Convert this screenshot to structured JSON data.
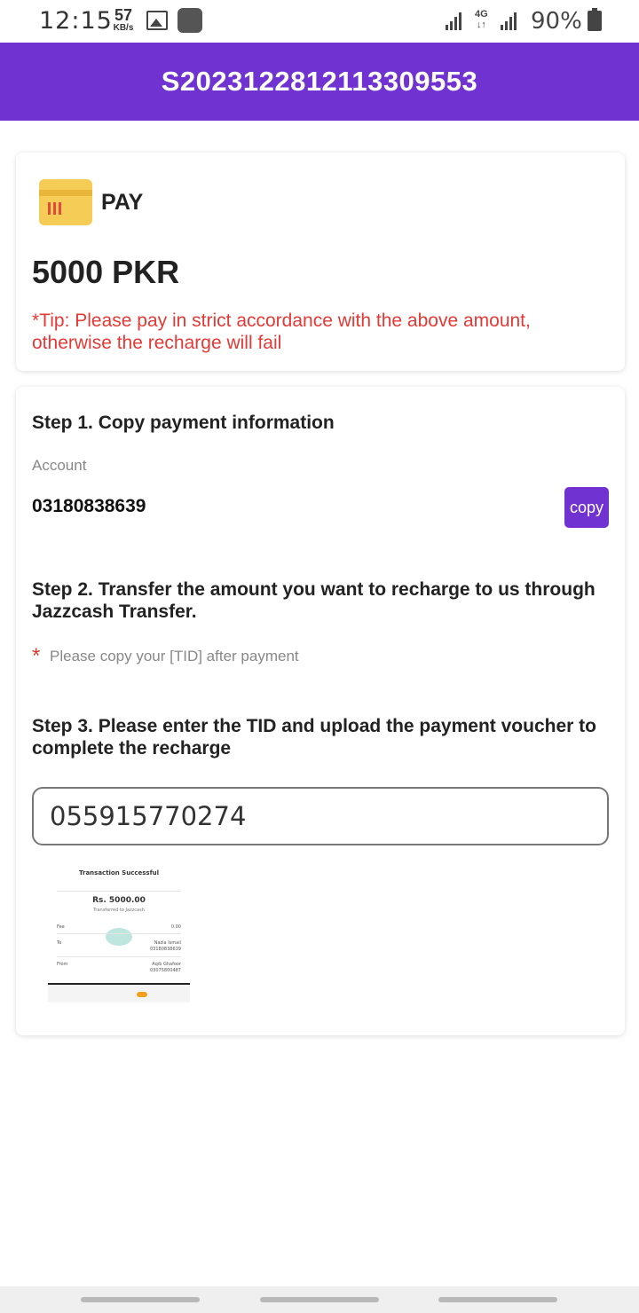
{
  "status_bar": {
    "time": "12:15",
    "speed_value": "57",
    "speed_unit": "KB/s",
    "network": "4G",
    "battery": "90%"
  },
  "header": {
    "order_id": "S2023122812113309553"
  },
  "pay_card": {
    "label": "PAY",
    "amount": "5000 PKR",
    "tip": "*Tip: Please pay in strict accordance with the above amount, otherwise the recharge will fail"
  },
  "steps": {
    "step1_title": "Step 1. Copy payment information",
    "account_label": "Account",
    "account_value": "03180838639",
    "copy_label": "copy",
    "step2_title": "Step 2. Transfer the amount you want to recharge to us through Jazzcash Transfer.",
    "required_mark": "*",
    "tid_hint": "Please copy your [TID] after payment",
    "step3_title": "Step 3. Please enter the TID and upload the payment voucher to complete the recharge",
    "tid_value": "055915770274"
  },
  "voucher": {
    "title": "Transaction Successful",
    "amount": "Rs. 5000.00",
    "subtitle": "Transferred to Jazzcash",
    "fee_label": "Fee",
    "fee_value": "0.00",
    "to_label": "To",
    "to_name": "Nazia Ismail",
    "to_number": "03180838639",
    "from_label": "From",
    "from_name": "Aqib Ghafoor",
    "from_number": "03075800487"
  },
  "colors": {
    "brand_purple": "#7033d2",
    "tip_red": "#e53935"
  }
}
